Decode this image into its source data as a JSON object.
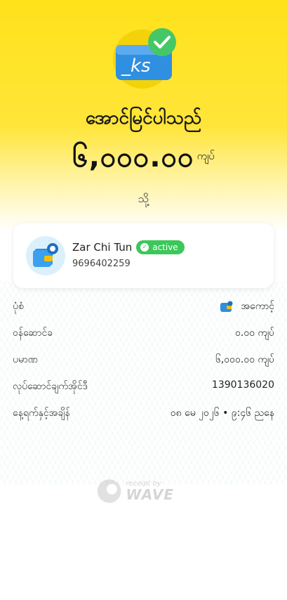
{
  "header": {
    "title": "အောင်မြင်ပါသည်",
    "amount": "၆,၀၀၀.၀၀",
    "currency": "ကျပ်",
    "to_label": "သို့"
  },
  "recipient": {
    "name": "Zar Chi Tun",
    "status": "active",
    "phone": "9696402259"
  },
  "details": [
    {
      "label": "ပုံစံ",
      "value": "အကောင့်",
      "icon": "wallet-icon"
    },
    {
      "label": "ဝန်ဆောင်ခ",
      "value": "၀.၀၀ ကျပ်"
    },
    {
      "label": "ပမာဏ",
      "value": "၆,၀၀၀.၀၀ ကျပ်"
    },
    {
      "label": "လုပ်ဆောင်ချက်အိုင်ဒီ",
      "value": "1390136020"
    },
    {
      "label": "နေ့ရက်နှင့်အချိန်",
      "value": "၀၈ မေ ၂၀၂၆ • ၉:၄၆ ညနေ"
    }
  ],
  "footer": {
    "receipt_by": "receipt by",
    "brand": "WAVE"
  },
  "colors": {
    "brand_yellow": "#ffe21a",
    "success_green": "#3cc75a",
    "wallet_blue": "#2f8fe0"
  }
}
